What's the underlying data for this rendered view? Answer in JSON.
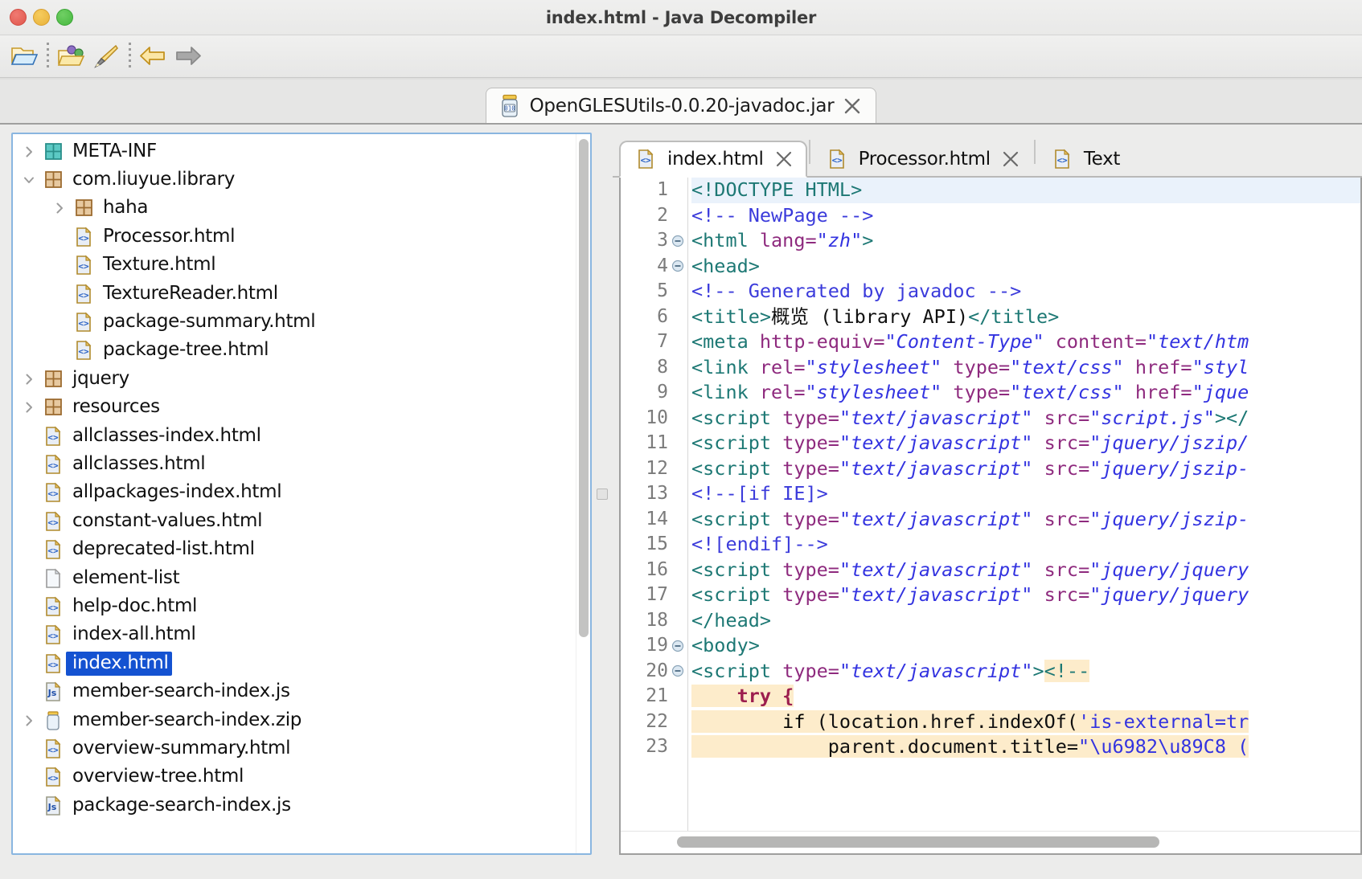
{
  "window": {
    "title": "index.html - Java Decompiler",
    "traffic_lights": [
      "close-button",
      "minimize-button",
      "zoom-button"
    ]
  },
  "toolbar": {
    "buttons": [
      {
        "name": "open-file-button",
        "icon": "open-folder-icon"
      },
      {
        "name": "separator-1",
        "icon": "dotted-separator"
      },
      {
        "name": "open-type-button",
        "icon": "folder-with-shapes-icon"
      },
      {
        "name": "search-button",
        "icon": "magic-wand-icon"
      },
      {
        "name": "separator-2",
        "icon": "dotted-separator"
      },
      {
        "name": "back-button",
        "icon": "arrow-left-icon"
      },
      {
        "name": "forward-button",
        "icon": "arrow-right-icon"
      }
    ]
  },
  "jar_tab": {
    "label": "OpenGLESUtils-0.0.20-javadoc.jar",
    "icon": "jar-icon",
    "close_icon": "close-icon"
  },
  "tree": {
    "items": [
      {
        "label": "META-INF",
        "icon": "package-icon-teal",
        "indent": 0,
        "twisty": "collapsed",
        "selected": false
      },
      {
        "label": "com.liuyue.library",
        "icon": "package-icon-brown",
        "indent": 0,
        "twisty": "expanded",
        "selected": false
      },
      {
        "label": "haha",
        "icon": "package-icon-brown",
        "indent": 1,
        "twisty": "collapsed",
        "selected": false
      },
      {
        "label": "Processor.html",
        "icon": "html-file-icon",
        "indent": 1,
        "twisty": "none",
        "selected": false
      },
      {
        "label": "Texture.html",
        "icon": "html-file-icon",
        "indent": 1,
        "twisty": "none",
        "selected": false
      },
      {
        "label": "TextureReader.html",
        "icon": "html-file-icon",
        "indent": 1,
        "twisty": "none",
        "selected": false
      },
      {
        "label": "package-summary.html",
        "icon": "html-file-icon",
        "indent": 1,
        "twisty": "none",
        "selected": false
      },
      {
        "label": "package-tree.html",
        "icon": "html-file-icon",
        "indent": 1,
        "twisty": "none",
        "selected": false
      },
      {
        "label": "jquery",
        "icon": "package-icon-brown",
        "indent": 0,
        "twisty": "collapsed",
        "selected": false
      },
      {
        "label": "resources",
        "icon": "package-icon-brown",
        "indent": 0,
        "twisty": "collapsed",
        "selected": false
      },
      {
        "label": "allclasses-index.html",
        "icon": "html-file-icon",
        "indent": 0,
        "twisty": "none",
        "selected": false
      },
      {
        "label": "allclasses.html",
        "icon": "html-file-icon",
        "indent": 0,
        "twisty": "none",
        "selected": false
      },
      {
        "label": "allpackages-index.html",
        "icon": "html-file-icon",
        "indent": 0,
        "twisty": "none",
        "selected": false
      },
      {
        "label": "constant-values.html",
        "icon": "html-file-icon",
        "indent": 0,
        "twisty": "none",
        "selected": false
      },
      {
        "label": "deprecated-list.html",
        "icon": "html-file-icon",
        "indent": 0,
        "twisty": "none",
        "selected": false
      },
      {
        "label": "element-list",
        "icon": "blank-file-icon",
        "indent": 0,
        "twisty": "none",
        "selected": false
      },
      {
        "label": "help-doc.html",
        "icon": "html-file-icon",
        "indent": 0,
        "twisty": "none",
        "selected": false
      },
      {
        "label": "index-all.html",
        "icon": "html-file-icon",
        "indent": 0,
        "twisty": "none",
        "selected": false
      },
      {
        "label": "index.html",
        "icon": "html-file-icon",
        "indent": 0,
        "twisty": "none",
        "selected": true
      },
      {
        "label": "member-search-index.js",
        "icon": "js-file-icon",
        "indent": 0,
        "twisty": "none",
        "selected": false
      },
      {
        "label": "member-search-index.zip",
        "icon": "jar-icon",
        "indent": 0,
        "twisty": "collapsed",
        "selected": false
      },
      {
        "label": "overview-summary.html",
        "icon": "html-file-icon",
        "indent": 0,
        "twisty": "none",
        "selected": false
      },
      {
        "label": "overview-tree.html",
        "icon": "html-file-icon",
        "indent": 0,
        "twisty": "none",
        "selected": false
      },
      {
        "label": "package-search-index.js",
        "icon": "js-file-icon",
        "indent": 0,
        "twisty": "none",
        "selected": false
      }
    ]
  },
  "editor": {
    "tabs": [
      {
        "label": "index.html",
        "icon": "html-file-icon",
        "active": true,
        "close_icon": "close-icon"
      },
      {
        "label": "Processor.html",
        "icon": "html-file-icon",
        "active": false,
        "close_icon": "close-icon"
      },
      {
        "label": "Text",
        "icon": "html-file-icon",
        "active": false,
        "close_icon": "close-icon"
      }
    ],
    "lines": [
      {
        "n": 1,
        "fold": false,
        "current": true,
        "tokens": [
          {
            "t": "tag",
            "s": "<!DOCTYPE HTML>"
          }
        ]
      },
      {
        "n": 2,
        "fold": false,
        "current": false,
        "tokens": [
          {
            "t": "com",
            "s": "<!-- NewPage -->"
          }
        ]
      },
      {
        "n": 3,
        "fold": true,
        "current": false,
        "tokens": [
          {
            "t": "tag",
            "s": "<html "
          },
          {
            "t": "attr",
            "s": "lang="
          },
          {
            "t": "val",
            "s": "\"zh\""
          },
          {
            "t": "tag",
            "s": ">"
          }
        ]
      },
      {
        "n": 4,
        "fold": true,
        "current": false,
        "tokens": [
          {
            "t": "tag",
            "s": "<head>"
          }
        ]
      },
      {
        "n": 5,
        "fold": false,
        "current": false,
        "tokens": [
          {
            "t": "com",
            "s": "<!-- Generated by javadoc -->"
          }
        ]
      },
      {
        "n": 6,
        "fold": false,
        "current": false,
        "tokens": [
          {
            "t": "tag",
            "s": "<title>"
          },
          {
            "t": "txt",
            "s": "概览 (library API)"
          },
          {
            "t": "tag",
            "s": "</title>"
          }
        ]
      },
      {
        "n": 7,
        "fold": false,
        "current": false,
        "tokens": [
          {
            "t": "tag",
            "s": "<meta "
          },
          {
            "t": "attr",
            "s": "http-equiv="
          },
          {
            "t": "val",
            "s": "\"Content-Type\""
          },
          {
            "t": "plain",
            "s": " "
          },
          {
            "t": "attr",
            "s": "content="
          },
          {
            "t": "val",
            "s": "\"text/htm"
          }
        ]
      },
      {
        "n": 8,
        "fold": false,
        "current": false,
        "tokens": [
          {
            "t": "tag",
            "s": "<link "
          },
          {
            "t": "attr",
            "s": "rel="
          },
          {
            "t": "val",
            "s": "\"stylesheet\""
          },
          {
            "t": "plain",
            "s": " "
          },
          {
            "t": "attr",
            "s": "type="
          },
          {
            "t": "val",
            "s": "\"text/css\""
          },
          {
            "t": "plain",
            "s": " "
          },
          {
            "t": "attr",
            "s": "href="
          },
          {
            "t": "val",
            "s": "\"styl"
          }
        ]
      },
      {
        "n": 9,
        "fold": false,
        "current": false,
        "tokens": [
          {
            "t": "tag",
            "s": "<link "
          },
          {
            "t": "attr",
            "s": "rel="
          },
          {
            "t": "val",
            "s": "\"stylesheet\""
          },
          {
            "t": "plain",
            "s": " "
          },
          {
            "t": "attr",
            "s": "type="
          },
          {
            "t": "val",
            "s": "\"text/css\""
          },
          {
            "t": "plain",
            "s": " "
          },
          {
            "t": "attr",
            "s": "href="
          },
          {
            "t": "val",
            "s": "\"jque"
          }
        ]
      },
      {
        "n": 10,
        "fold": false,
        "current": false,
        "tokens": [
          {
            "t": "tag",
            "s": "<script "
          },
          {
            "t": "attr",
            "s": "type="
          },
          {
            "t": "val",
            "s": "\"text/javascript\""
          },
          {
            "t": "plain",
            "s": " "
          },
          {
            "t": "attr",
            "s": "src="
          },
          {
            "t": "val",
            "s": "\"script.js\""
          },
          {
            "t": "tag",
            "s": "></"
          }
        ]
      },
      {
        "n": 11,
        "fold": false,
        "current": false,
        "tokens": [
          {
            "t": "tag",
            "s": "<script "
          },
          {
            "t": "attr",
            "s": "type="
          },
          {
            "t": "val",
            "s": "\"text/javascript\""
          },
          {
            "t": "plain",
            "s": " "
          },
          {
            "t": "attr",
            "s": "src="
          },
          {
            "t": "val",
            "s": "\"jquery/jszip/"
          }
        ]
      },
      {
        "n": 12,
        "fold": false,
        "current": false,
        "tokens": [
          {
            "t": "tag",
            "s": "<script "
          },
          {
            "t": "attr",
            "s": "type="
          },
          {
            "t": "val",
            "s": "\"text/javascript\""
          },
          {
            "t": "plain",
            "s": " "
          },
          {
            "t": "attr",
            "s": "src="
          },
          {
            "t": "val",
            "s": "\"jquery/jszip-"
          }
        ]
      },
      {
        "n": 13,
        "fold": false,
        "current": false,
        "tokens": [
          {
            "t": "com",
            "s": "<!--[if IE]>"
          }
        ]
      },
      {
        "n": 14,
        "fold": false,
        "current": false,
        "tokens": [
          {
            "t": "tag",
            "s": "<script "
          },
          {
            "t": "attr",
            "s": "type="
          },
          {
            "t": "val",
            "s": "\"text/javascript\""
          },
          {
            "t": "plain",
            "s": " "
          },
          {
            "t": "attr",
            "s": "src="
          },
          {
            "t": "val",
            "s": "\"jquery/jszip-"
          }
        ]
      },
      {
        "n": 15,
        "fold": false,
        "current": false,
        "tokens": [
          {
            "t": "com",
            "s": "<![endif]-->"
          }
        ]
      },
      {
        "n": 16,
        "fold": false,
        "current": false,
        "tokens": [
          {
            "t": "tag",
            "s": "<script "
          },
          {
            "t": "attr",
            "s": "type="
          },
          {
            "t": "val",
            "s": "\"text/javascript\""
          },
          {
            "t": "plain",
            "s": " "
          },
          {
            "t": "attr",
            "s": "src="
          },
          {
            "t": "val",
            "s": "\"jquery/jquery"
          }
        ]
      },
      {
        "n": 17,
        "fold": false,
        "current": false,
        "tokens": [
          {
            "t": "tag",
            "s": "<script "
          },
          {
            "t": "attr",
            "s": "type="
          },
          {
            "t": "val",
            "s": "\"text/javascript\""
          },
          {
            "t": "plain",
            "s": " "
          },
          {
            "t": "attr",
            "s": "src="
          },
          {
            "t": "val",
            "s": "\"jquery/jquery"
          }
        ]
      },
      {
        "n": 18,
        "fold": false,
        "current": false,
        "tokens": [
          {
            "t": "tag",
            "s": "</head>"
          }
        ]
      },
      {
        "n": 19,
        "fold": true,
        "current": false,
        "tokens": [
          {
            "t": "tag",
            "s": "<body>"
          }
        ]
      },
      {
        "n": 20,
        "fold": true,
        "current": false,
        "tokens": [
          {
            "t": "tag",
            "s": "<script "
          },
          {
            "t": "attr",
            "s": "type="
          },
          {
            "t": "val",
            "s": "\"text/javascript\""
          },
          {
            "t": "tag",
            "s": ">"
          },
          {
            "t": "hl-tag",
            "s": "<!--"
          }
        ]
      },
      {
        "n": 21,
        "fold": false,
        "current": false,
        "tokens": [
          {
            "t": "hl-kw",
            "s": "    try {"
          }
        ]
      },
      {
        "n": 22,
        "fold": false,
        "current": false,
        "tokens": [
          {
            "t": "hl-kw2",
            "s": "        if "
          },
          {
            "t": "hl-plain",
            "s": "(location.href.indexOf("
          },
          {
            "t": "hl-str",
            "s": "'is-external=tr"
          }
        ]
      },
      {
        "n": 23,
        "fold": false,
        "current": false,
        "tokens": [
          {
            "t": "hl-plain",
            "s": "            parent.document.title="
          },
          {
            "t": "hl-str",
            "s": "\"\\u6982\\u89C8 ("
          }
        ]
      }
    ]
  }
}
